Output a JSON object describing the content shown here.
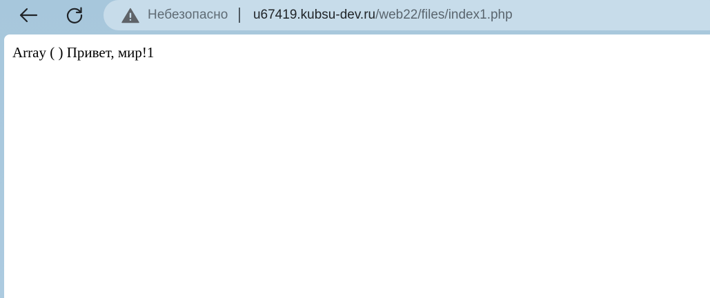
{
  "browser": {
    "security": {
      "icon": "warning-triangle-icon",
      "label": "Небезопасно"
    },
    "address": {
      "host": "u67419.kubsu-dev.ru",
      "path": "/web22/files/index1.php"
    }
  },
  "page": {
    "body_text": "Array ( ) Привет, мир!1"
  }
}
